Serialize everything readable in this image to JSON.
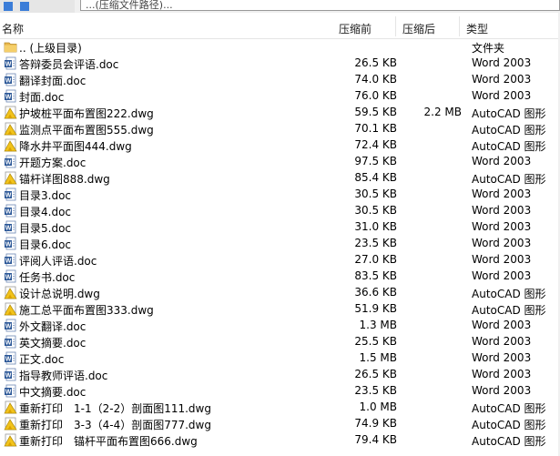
{
  "title_bar": {
    "path_text": "...(压缩文件路径)..."
  },
  "columns": {
    "name": "名称",
    "compressed": "压缩前",
    "original": "压缩后",
    "type": "类型"
  },
  "rows": [
    {
      "name": ".. (上级目录)",
      "size": "",
      "osize": "",
      "type": "文件夹",
      "icon": "folder-icon"
    },
    {
      "name": "答辩委员会评语.doc",
      "size": "26.5 KB",
      "osize": "",
      "type": "Word 2003",
      "icon": "word-doc-icon"
    },
    {
      "name": "翻译封面.doc",
      "size": "74.0 KB",
      "osize": "",
      "type": "Word 2003",
      "icon": "word-doc-icon"
    },
    {
      "name": "封面.doc",
      "size": "76.0 KB",
      "osize": "",
      "type": "Word 2003",
      "icon": "word-doc-icon"
    },
    {
      "name": "护坡桩平面布置图222.dwg",
      "size": "59.5 KB",
      "osize": "2.2 MB",
      "type": "AutoCAD 图形",
      "icon": "autocad-dwg-icon"
    },
    {
      "name": "监测点平面布置图555.dwg",
      "size": "70.1 KB",
      "osize": "",
      "type": "AutoCAD 图形",
      "icon": "autocad-dwg-icon"
    },
    {
      "name": "降水井平面图444.dwg",
      "size": "72.4 KB",
      "osize": "",
      "type": "AutoCAD 图形",
      "icon": "autocad-dwg-icon"
    },
    {
      "name": "开题方案.doc",
      "size": "97.5 KB",
      "osize": "",
      "type": "Word 2003",
      "icon": "word-doc-icon"
    },
    {
      "name": "锚杆详图888.dwg",
      "size": "85.4 KB",
      "osize": "",
      "type": "AutoCAD 图形",
      "icon": "autocad-dwg-icon"
    },
    {
      "name": "目录3.doc",
      "size": "30.5 KB",
      "osize": "",
      "type": "Word 2003",
      "icon": "word-doc-icon"
    },
    {
      "name": "目录4.doc",
      "size": "30.5 KB",
      "osize": "",
      "type": "Word 2003",
      "icon": "word-doc-icon"
    },
    {
      "name": "目录5.doc",
      "size": "31.0 KB",
      "osize": "",
      "type": "Word 2003",
      "icon": "word-doc-icon"
    },
    {
      "name": "目录6.doc",
      "size": "23.5 KB",
      "osize": "",
      "type": "Word 2003",
      "icon": "word-doc-icon"
    },
    {
      "name": "评阅人评语.doc",
      "size": "27.0 KB",
      "osize": "",
      "type": "Word 2003",
      "icon": "word-doc-icon"
    },
    {
      "name": "任务书.doc",
      "size": "83.5 KB",
      "osize": "",
      "type": "Word 2003",
      "icon": "word-doc-icon"
    },
    {
      "name": "设计总说明.dwg",
      "size": "36.6 KB",
      "osize": "",
      "type": "AutoCAD 图形",
      "icon": "autocad-dwg-icon"
    },
    {
      "name": "施工总平面布置图333.dwg",
      "size": "51.9 KB",
      "osize": "",
      "type": "AutoCAD 图形",
      "icon": "autocad-dwg-icon"
    },
    {
      "name": "外文翻译.doc",
      "size": "1.3 MB",
      "osize": "",
      "type": "Word 2003",
      "icon": "word-doc-icon"
    },
    {
      "name": "英文摘要.doc",
      "size": "25.5 KB",
      "osize": "",
      "type": "Word 2003",
      "icon": "word-doc-icon"
    },
    {
      "name": "正文.doc",
      "size": "1.5 MB",
      "osize": "",
      "type": "Word 2003",
      "icon": "word-doc-icon"
    },
    {
      "name": "指导教师评语.doc",
      "size": "26.5 KB",
      "osize": "",
      "type": "Word 2003",
      "icon": "word-doc-icon"
    },
    {
      "name": "中文摘要.doc",
      "size": "23.5 KB",
      "osize": "",
      "type": "Word 2003",
      "icon": "word-doc-icon"
    },
    {
      "name": "重新打印　1-1（2-2）剖面图111.dwg",
      "size": "1.0 MB",
      "osize": "",
      "type": "AutoCAD 图形",
      "icon": "autocad-dwg-icon"
    },
    {
      "name": "重新打印　3-3（4-4）剖面图777.dwg",
      "size": "74.9 KB",
      "osize": "",
      "type": "AutoCAD 图形",
      "icon": "autocad-dwg-icon"
    },
    {
      "name": "重新打印　锚杆平面布置图666.dwg",
      "size": "79.4 KB",
      "osize": "",
      "type": "AutoCAD 图形",
      "icon": "autocad-dwg-icon"
    }
  ],
  "colors": {
    "folder": "#e8b64a",
    "word_blue": "#2b5797",
    "cad_yellow": "#f2c31b",
    "header_border": "#e5e5e5"
  }
}
